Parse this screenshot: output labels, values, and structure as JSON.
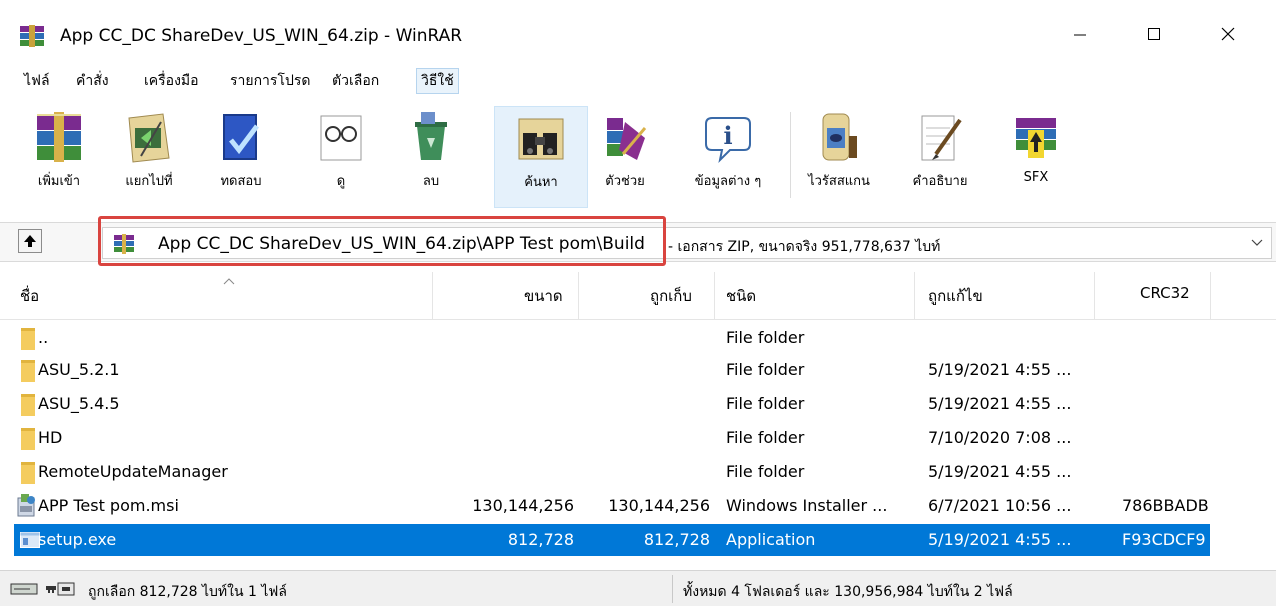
{
  "window": {
    "title": "App CC_DC ShareDev_US_WIN_64.zip - WinRAR",
    "minimize_glyph": "—",
    "maximize_glyph": "☐",
    "close_glyph": "✕"
  },
  "menu": [
    {
      "label": "ไฟล์"
    },
    {
      "label": "คำสั่ง"
    },
    {
      "label": "เครื่องมือ"
    },
    {
      "label": "รายการโปรด"
    },
    {
      "label": "ตัวเลือก"
    },
    {
      "label": "วิธีใช้",
      "active": true
    }
  ],
  "toolbar": [
    {
      "label": "เพิ่มเข้า",
      "icon": "add-archive-icon"
    },
    {
      "label": "แยกไปที่",
      "icon": "extract-to-icon"
    },
    {
      "label": "ทดสอบ",
      "icon": "test-icon"
    },
    {
      "label": "ดู",
      "icon": "view-icon"
    },
    {
      "label": "ลบ",
      "icon": "delete-icon"
    },
    {
      "label": "ค้นหา",
      "icon": "find-icon",
      "active": true
    },
    {
      "label": "ตัวช่วย",
      "icon": "wizard-icon"
    },
    {
      "label": "ข้อมูลต่าง ๆ",
      "icon": "info-icon"
    },
    {
      "label": "ไวรัสสแกน",
      "icon": "virus-scan-icon"
    },
    {
      "label": "คำอธิบาย",
      "icon": "comment-icon"
    },
    {
      "label": "SFX",
      "icon": "sfx-icon"
    }
  ],
  "address": {
    "path": "App CC_DC ShareDev_US_WIN_64.zip\\APP Test pom\\Build",
    "info": "- เอกสาร ZIP, ขนาดจริง 951,778,637 ไบท์"
  },
  "columns": {
    "name": "ชื่อ",
    "size": "ขนาด",
    "packed": "ถูกเก็บ",
    "type": "ชนิด",
    "modified": "ถูกแก้ไข",
    "crc": "CRC32"
  },
  "files": [
    {
      "name": "..",
      "size": "",
      "packed": "",
      "type": "File folder",
      "modified": "",
      "crc": "",
      "icon": "folder-icon"
    },
    {
      "name": "ASU_5.2.1",
      "size": "",
      "packed": "",
      "type": "File folder",
      "modified": "5/19/2021 4:55 ...",
      "crc": "",
      "icon": "folder-icon"
    },
    {
      "name": "ASU_5.4.5",
      "size": "",
      "packed": "",
      "type": "File folder",
      "modified": "5/19/2021 4:55 ...",
      "crc": "",
      "icon": "folder-icon"
    },
    {
      "name": "HD",
      "size": "",
      "packed": "",
      "type": "File folder",
      "modified": "7/10/2020 7:08 ...",
      "crc": "",
      "icon": "folder-icon"
    },
    {
      "name": "RemoteUpdateManager",
      "size": "",
      "packed": "",
      "type": "File folder",
      "modified": "5/19/2021 4:55 ...",
      "crc": "",
      "icon": "folder-icon"
    },
    {
      "name": "APP Test pom.msi",
      "size": "130,144,256",
      "packed": "130,144,256",
      "type": "Windows Installer ...",
      "modified": "6/7/2021 10:56 ...",
      "crc": "786BBADB",
      "icon": "msi-icon"
    },
    {
      "name": "setup.exe",
      "size": "812,728",
      "packed": "812,728",
      "type": "Application",
      "modified": "5/19/2021 4:55 ...",
      "crc": "F93CDCF9",
      "icon": "exe-icon",
      "selected": true
    }
  ],
  "status": {
    "left": "ถูกเลือก 812,728 ไบท์ใน 1 ไฟล์",
    "right": "ทั้งหมด 4 โฟลเดอร์ และ 130,956,984 ไบท์ใน 2 ไฟล์"
  },
  "colors": {
    "selection": "#0078d7",
    "highlight_box": "#d9443f"
  }
}
